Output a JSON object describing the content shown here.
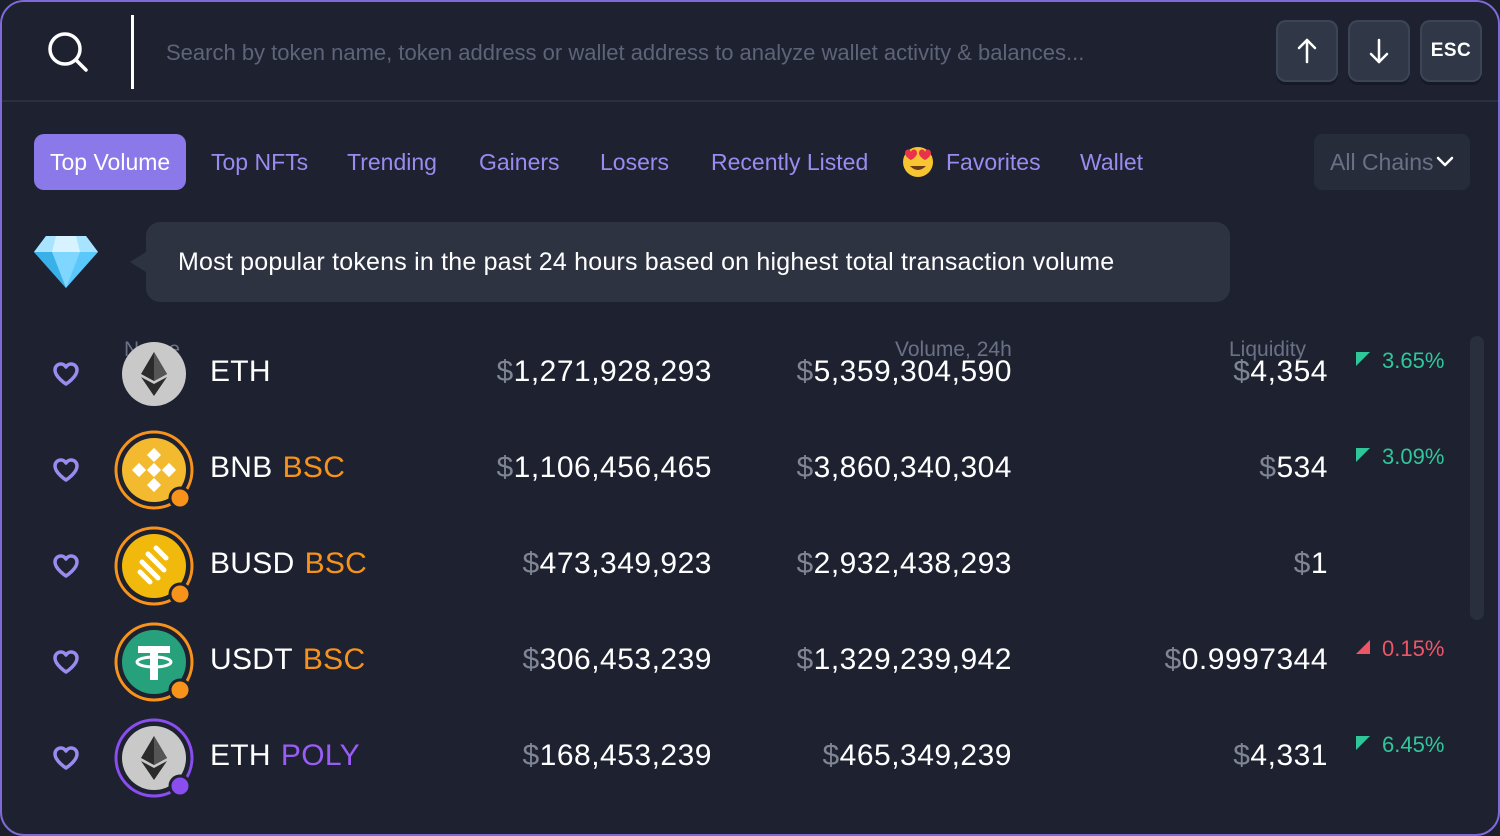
{
  "search": {
    "placeholder": "Search by token name, token address or wallet address to analyze wallet activity & balances...",
    "keys": {
      "up": "up-arrow",
      "down": "down-arrow",
      "esc": "ESC"
    }
  },
  "tabs": [
    {
      "label": "Top Volume",
      "active": true
    },
    {
      "label": "Top NFTs"
    },
    {
      "label": "Trending"
    },
    {
      "label": "Gainers"
    },
    {
      "label": "Losers"
    },
    {
      "label": "Recently Listed"
    },
    {
      "label": "Favorites",
      "icon": "heart-eyes-emoji-icon"
    },
    {
      "label": "Wallet"
    }
  ],
  "chain_select": {
    "label": "All Chains"
  },
  "banner": {
    "icon": "diamond-icon",
    "text": "Most popular tokens in the past 24 hours based on highest total transaction volume"
  },
  "table": {
    "headers": {
      "name": "Name",
      "volume": "Volume, 24h",
      "liquidity": "Liquidity"
    },
    "currency_symbol": "$",
    "rows": [
      {
        "token": "ETH",
        "chain": "",
        "col1": "1,271,928,293",
        "volume": "5,359,304,590",
        "liquidity": "4,354",
        "change": "3.65%",
        "direction": "up",
        "icon": "ethereum-icon"
      },
      {
        "token": "BNB",
        "chain": "BSC",
        "col1": "1,106,456,465",
        "volume": "3,860,340,304",
        "liquidity": "534",
        "change": "3.09%",
        "direction": "up",
        "icon": "bnb-icon"
      },
      {
        "token": "BUSD",
        "chain": "BSC",
        "col1": "473,349,923",
        "volume": "2,932,438,293",
        "liquidity": "1",
        "change": "",
        "direction": "",
        "icon": "busd-icon"
      },
      {
        "token": "USDT",
        "chain": "BSC",
        "col1": "306,453,239",
        "volume": "1,329,239,942",
        "liquidity": "0.9997344",
        "change": "0.15%",
        "direction": "down",
        "icon": "tether-icon"
      },
      {
        "token": "ETH",
        "chain": "POLY",
        "col1": "168,453,239",
        "volume": "465,349,239",
        "liquidity": "4,331",
        "change": "6.45%",
        "direction": "up",
        "icon": "ethereum-icon"
      }
    ]
  },
  "colors": {
    "accent": "#8b79ea",
    "bsc": "#f7931a",
    "poly": "#9a5cf5",
    "positive": "#2fc79a",
    "negative": "#ee5566"
  }
}
